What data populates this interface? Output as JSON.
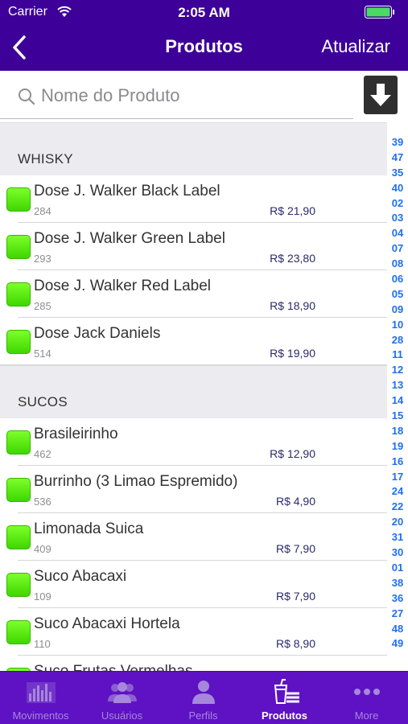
{
  "status_bar": {
    "carrier": "Carrier",
    "time": "2:05 AM"
  },
  "nav": {
    "title": "Produtos",
    "action_label": "Atualizar"
  },
  "search": {
    "placeholder": "Nome do Produto",
    "value": ""
  },
  "sections": [
    {
      "title": "WHISKY",
      "items": [
        {
          "name": "Dose J. Walker Black Label",
          "code": "284",
          "price": "R$ 21,90"
        },
        {
          "name": "Dose J. Walker Green Label",
          "code": "293",
          "price": "R$ 23,80"
        },
        {
          "name": "Dose J. Walker Red Label",
          "code": "285",
          "price": "R$ 18,90"
        },
        {
          "name": "Dose Jack Daniels",
          "code": "514",
          "price": "R$ 19,90"
        }
      ]
    },
    {
      "title": "SUCOS",
      "items": [
        {
          "name": "Brasileirinho",
          "code": "462",
          "price": "R$ 12,90"
        },
        {
          "name": "Burrinho (3 Limao Espremido)",
          "code": "536",
          "price": "R$ 4,90"
        },
        {
          "name": "Limonada Suica",
          "code": "409",
          "price": "R$ 7,90"
        },
        {
          "name": "Suco Abacaxi",
          "code": "109",
          "price": "R$ 7,90"
        },
        {
          "name": "Suco Abacaxi Hortela",
          "code": "110",
          "price": "R$ 8,90"
        },
        {
          "name": "Suco Frutas Vermelhas",
          "code": "",
          "price": ""
        }
      ]
    }
  ],
  "index_items": [
    "39",
    "47",
    "35",
    "40",
    "02",
    "03",
    "04",
    "07",
    "08",
    "06",
    "05",
    "09",
    "10",
    "28",
    "11",
    "12",
    "13",
    "14",
    "15",
    "18",
    "19",
    "16",
    "17",
    "24",
    "22",
    "20",
    "31",
    "30",
    "01",
    "38",
    "36",
    "27",
    "48",
    "49"
  ],
  "tabs": [
    {
      "label": "Movimentos",
      "icon": "chart-bars-icon",
      "active": false
    },
    {
      "label": "Usuários",
      "icon": "users-icon",
      "active": false
    },
    {
      "label": "Perfils",
      "icon": "person-icon",
      "active": false
    },
    {
      "label": "Produtos",
      "icon": "drink-food-icon",
      "active": true
    },
    {
      "label": "More",
      "icon": "more-dots-icon",
      "active": false
    }
  ],
  "colors": {
    "header_bg": "#3d0099",
    "tabbar_bg": "#5e12c4",
    "index_blue": "#1e6ff0",
    "indicator_green": "#4fe10a"
  }
}
